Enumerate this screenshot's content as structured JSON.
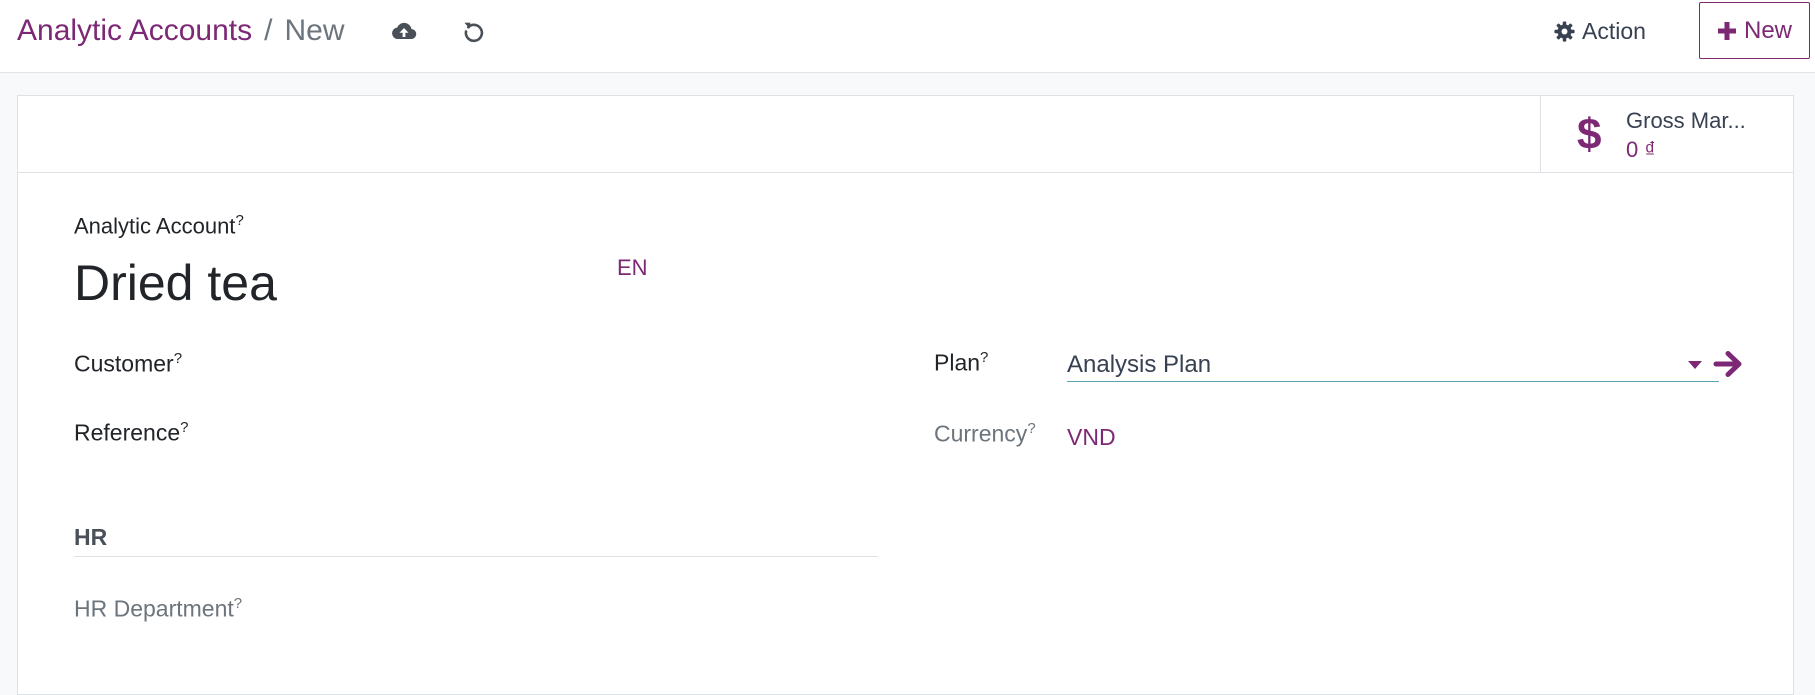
{
  "breadcrumb": {
    "parent": "Analytic Accounts",
    "separator": "/",
    "current": "New"
  },
  "toolbar": {
    "save_icon": "cloud-upload-icon",
    "discard_icon": "undo-icon",
    "action_label": "Action",
    "action_icon": "gear-icon",
    "new_label": "New",
    "new_icon": "plus-icon"
  },
  "stat_button": {
    "icon": "dollar-icon",
    "symbol": "$",
    "label": "Gross Mar...",
    "value": "0 ₫"
  },
  "form": {
    "name_label": "Analytic Account",
    "name_value": "Dried tea",
    "language": "EN",
    "customer_label": "Customer",
    "reference_label": "Reference",
    "plan_label": "Plan",
    "plan_value": "Analysis Plan",
    "currency_label": "Currency",
    "currency_value": "VND",
    "help_mark": "?",
    "hr_section_title": "HR",
    "hr_department_label": "HR Department"
  },
  "colors": {
    "accent": "#7c2874",
    "input_underline": "#56a5b0",
    "muted_text": "#6c757d"
  }
}
